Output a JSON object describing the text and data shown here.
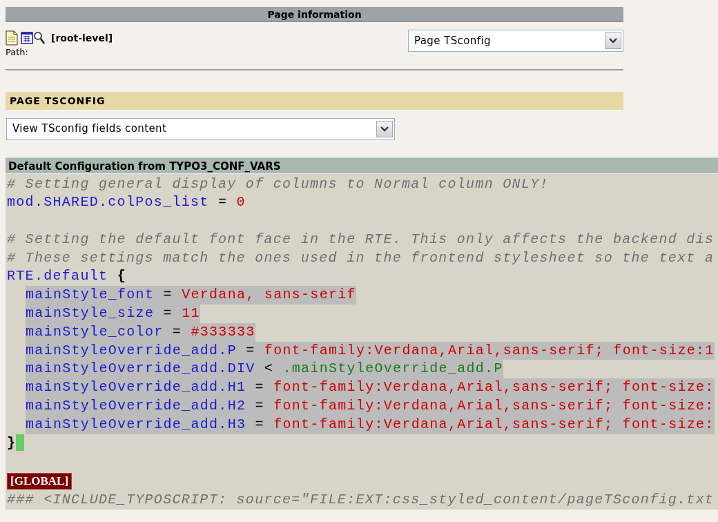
{
  "header": {
    "title": "Page information"
  },
  "page": {
    "title": "[root-level]",
    "path_label": "Path:"
  },
  "view_select": {
    "value": "Page TSconfig"
  },
  "section": {
    "title": "PAGE TSCONFIG"
  },
  "mode_select": {
    "value": "View TSconfig fields content"
  },
  "code_panel": {
    "title": "Default Configuration from TYPO3_CONF_VARS",
    "lines": [
      {
        "kind": "code",
        "tokens": [
          {
            "kind": "comment",
            "text": "# Setting general display of columns to Normal column ONLY!"
          }
        ]
      },
      {
        "kind": "code",
        "tokens": [
          {
            "kind": "key",
            "text": "mod.SHARED.colPos_list"
          },
          {
            "kind": "op",
            "text": " = "
          },
          {
            "kind": "value",
            "text": "0"
          }
        ]
      },
      {
        "kind": "blank"
      },
      {
        "kind": "code",
        "tokens": [
          {
            "kind": "comment",
            "text": "# Setting the default font face in the RTE. This only affects the backend dis"
          }
        ]
      },
      {
        "kind": "code",
        "tokens": [
          {
            "kind": "comment",
            "text": "# These settings match the ones used in the frontend stylesheet so the text a"
          }
        ]
      },
      {
        "kind": "code",
        "tokens": [
          {
            "kind": "key",
            "text": "RTE.default"
          },
          {
            "kind": "brace",
            "text": " {"
          }
        ],
        "children": [
          {
            "kind": "code",
            "tokens": [
              {
                "kind": "key",
                "text": "mainStyle_font"
              },
              {
                "kind": "op",
                "text": " = "
              },
              {
                "kind": "value",
                "text": "Verdana, sans-serif"
              }
            ]
          },
          {
            "kind": "code",
            "tokens": [
              {
                "kind": "key",
                "text": "mainStyle_size"
              },
              {
                "kind": "op",
                "text": " = "
              },
              {
                "kind": "value",
                "text": "11"
              }
            ]
          },
          {
            "kind": "code",
            "tokens": [
              {
                "kind": "key",
                "text": "mainStyle_color"
              },
              {
                "kind": "op",
                "text": " = "
              },
              {
                "kind": "value",
                "text": "#333333"
              }
            ]
          },
          {
            "kind": "code",
            "tokens": [
              {
                "kind": "key",
                "text": "mainStyleOverride_add.P"
              },
              {
                "kind": "op",
                "text": " = "
              },
              {
                "kind": "value",
                "text": "font-family:Verdana,Arial,sans-serif; font-size:1"
              }
            ]
          },
          {
            "kind": "code",
            "tokens": [
              {
                "kind": "key",
                "text": "mainStyleOverride_add.DIV"
              },
              {
                "kind": "op",
                "text": " < "
              },
              {
                "kind": "ref",
                "text": ".mainStyleOverride_add.P"
              }
            ]
          },
          {
            "kind": "code",
            "tokens": [
              {
                "kind": "key",
                "text": "mainStyleOverride_add.H1"
              },
              {
                "kind": "op",
                "text": " = "
              },
              {
                "kind": "value",
                "text": "font-family:Verdana,Arial,sans-serif; font-size:"
              }
            ]
          },
          {
            "kind": "code",
            "tokens": [
              {
                "kind": "key",
                "text": "mainStyleOverride_add.H2"
              },
              {
                "kind": "op",
                "text": " = "
              },
              {
                "kind": "value",
                "text": "font-family:Verdana,Arial,sans-serif; font-size:"
              }
            ]
          },
          {
            "kind": "code",
            "tokens": [
              {
                "kind": "key",
                "text": "mainStyleOverride_add.H3"
              },
              {
                "kind": "op",
                "text": " = "
              },
              {
                "kind": "value",
                "text": "font-family:Verdana,Arial,sans-serif; font-size:"
              }
            ]
          }
        ]
      },
      {
        "kind": "code",
        "cursor": true,
        "tokens": [
          {
            "kind": "brace",
            "text": "}"
          }
        ]
      },
      {
        "kind": "blank"
      },
      {
        "kind": "badge",
        "text": "[GLOBAL]"
      },
      {
        "kind": "code",
        "tokens": [
          {
            "kind": "comment",
            "text": "### <INCLUDE_TYPOSCRIPT: source=\"FILE:EXT:css_styled_content/pageTSconfig.txt"
          }
        ]
      }
    ]
  }
}
